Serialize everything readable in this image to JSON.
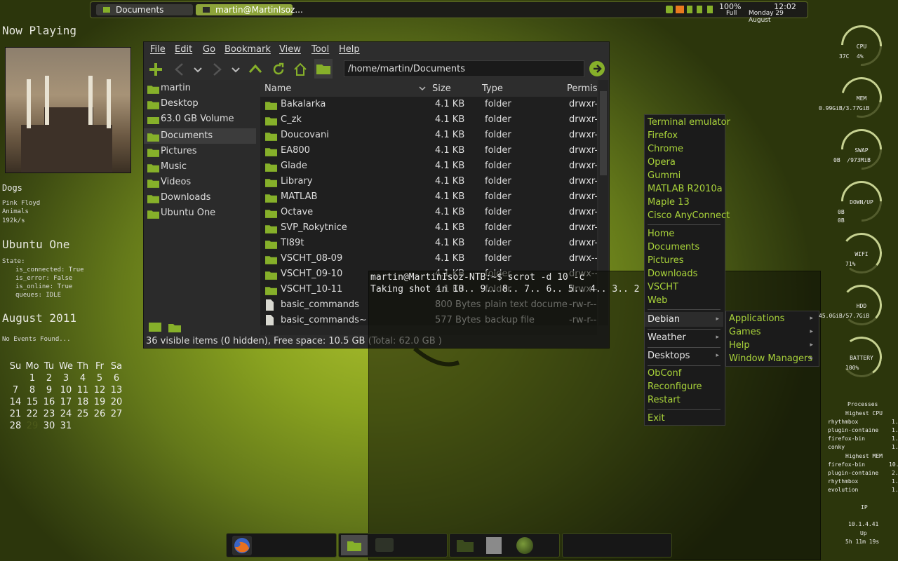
{
  "top_panel": {
    "tasks": [
      {
        "label": "Documents",
        "active": false
      },
      {
        "label": "martin@MartinIsoz...",
        "active": true
      }
    ],
    "battery_percent": "100%",
    "battery_state": "Full",
    "time": "12:02",
    "date": "Monday 29 August"
  },
  "left_conky": {
    "now_playing_title": "Now Playing",
    "track": "Dogs",
    "artist": "Pink Floyd",
    "album": "Animals",
    "bitrate": "192k/s",
    "ubuntu_one_title": "Ubuntu One",
    "state_label": "State:",
    "state_lines": [
      "is_connected: True",
      "is_error: False",
      "is_online: True",
      "queues: IDLE"
    ],
    "calendar_title": "August 2011",
    "events": "No Events Found...",
    "weekdays": [
      "Su",
      "Mo",
      "Tu",
      "We",
      "Th",
      "Fr",
      "Sa"
    ],
    "weeks": [
      [
        "",
        "1",
        "2",
        "3",
        "4",
        "5",
        "6"
      ],
      [
        "7",
        "8",
        "9",
        "10",
        "11",
        "12",
        "13"
      ],
      [
        "14",
        "15",
        "16",
        "17",
        "18",
        "19",
        "20"
      ],
      [
        "21",
        "22",
        "23",
        "24",
        "25",
        "26",
        "27"
      ],
      [
        "28",
        "29",
        "30",
        "31",
        "",
        "",
        ""
      ]
    ],
    "today": "29"
  },
  "file_manager": {
    "menu": [
      "File",
      "Edit",
      "Go",
      "Bookmark",
      "View",
      "Tool",
      "Help"
    ],
    "address": "/home/martin/Documents",
    "sidebar": [
      {
        "label": "martin",
        "selected": false
      },
      {
        "label": "Desktop",
        "selected": false
      },
      {
        "label": "63.0 GB Volume",
        "selected": false
      },
      {
        "label": "Documents",
        "selected": true
      },
      {
        "label": "Pictures",
        "selected": false
      },
      {
        "label": "Music",
        "selected": false
      },
      {
        "label": "Videos",
        "selected": false
      },
      {
        "label": "Downloads",
        "selected": false
      },
      {
        "label": "Ubuntu One",
        "selected": false
      }
    ],
    "columns": [
      "Name",
      "Size",
      "Type",
      "Permis"
    ],
    "rows": [
      {
        "name": "Bakalarka",
        "size": "4.1 KB",
        "type": "folder",
        "perm": "drwxr-:",
        "kind": "folder"
      },
      {
        "name": "C_zk",
        "size": "4.1 KB",
        "type": "folder",
        "perm": "drwxr-:",
        "kind": "folder"
      },
      {
        "name": "Doucovani",
        "size": "4.1 KB",
        "type": "folder",
        "perm": "drwxr-:",
        "kind": "folder"
      },
      {
        "name": "EA800",
        "size": "4.1 KB",
        "type": "folder",
        "perm": "drwxr-:",
        "kind": "folder"
      },
      {
        "name": "Glade",
        "size": "4.1 KB",
        "type": "folder",
        "perm": "drwxr-:",
        "kind": "folder"
      },
      {
        "name": "Library",
        "size": "4.1 KB",
        "type": "folder",
        "perm": "drwxr-:",
        "kind": "folder"
      },
      {
        "name": "MATLAB",
        "size": "4.1 KB",
        "type": "folder",
        "perm": "drwxr-:",
        "kind": "folder"
      },
      {
        "name": "Octave",
        "size": "4.1 KB",
        "type": "folder",
        "perm": "drwxr-:",
        "kind": "folder"
      },
      {
        "name": "SVP_Rokytnice",
        "size": "4.1 KB",
        "type": "folder",
        "perm": "drwxr-:",
        "kind": "folder"
      },
      {
        "name": "TI89t",
        "size": "4.1 KB",
        "type": "folder",
        "perm": "drwxr-:",
        "kind": "folder"
      },
      {
        "name": "VSCHT_08-09",
        "size": "4.1 KB",
        "type": "folder",
        "perm": "drwx--",
        "kind": "folder"
      },
      {
        "name": "VSCHT_09-10",
        "size": "4.1 KB",
        "type": "folder",
        "perm": "drwx--",
        "kind": "folder"
      },
      {
        "name": "VSCHT_10-11",
        "size": "4.1 KB",
        "type": "folder",
        "perm": "drwx--",
        "kind": "folder"
      },
      {
        "name": "basic_commands",
        "size": "800 Bytes",
        "type": "plain text docume",
        "perm": "-rw-r--r",
        "kind": "file"
      },
      {
        "name": "basic_commands~",
        "size": "577 Bytes",
        "type": "backup file",
        "perm": "-rw-r--r",
        "kind": "file"
      }
    ],
    "status": "36 visible items (0 hidden), Free space: 10.5 GB (Total: 62.0 GB )"
  },
  "terminal": {
    "lines": [
      "martin@MartinIsoz-NTB:~$ scrot -d 10 -c",
      "Taking shot in 10.. 9.. 8.. 7.. 6.. 5.. 4.. 3.. 2"
    ]
  },
  "openbox_menu": {
    "groups": [
      [
        "Terminal emulator",
        "Firefox",
        "Chrome",
        "Opera",
        "Gummi",
        "MATLAB R2010a",
        "Maple 13",
        "Cisco AnyConnect"
      ],
      [
        "Home",
        "Documents",
        "Pictures",
        "Downloads",
        "VSCHT",
        "Web"
      ]
    ],
    "submenus": [
      [
        "Debian"
      ],
      [
        "Weather"
      ],
      [
        "Desktops"
      ]
    ],
    "actions": [
      "ObConf",
      "Reconfigure",
      "Restart"
    ],
    "exit": "Exit",
    "debian_submenu": [
      "Applications",
      "Games",
      "Help",
      "Window Managers"
    ]
  },
  "right_conky": {
    "rings": [
      {
        "label": "CPU",
        "value": "4%",
        "extra": "37C",
        "level": 0.04
      },
      {
        "label": "MEM",
        "value": "0.99GiB/3.77GiB",
        "level": 0.26
      },
      {
        "label": "SWAP",
        "value": "0B  /973MiB",
        "level": 0.0
      },
      {
        "label": "DOWN/UP",
        "value": "",
        "level": 0.0
      },
      {
        "label": "WIFI",
        "value": "71%",
        "level": 0.71
      },
      {
        "label": "HDD",
        "value": "45.0GiB/57.7GiB",
        "level": 0.78
      },
      {
        "label": "BATTERY",
        "value": "100%",
        "level": 1.0
      }
    ],
    "down": "0B",
    "up": "0B",
    "processes_title": "Processes",
    "highest_cpu_title": "Highest CPU",
    "highest_cpu": [
      [
        "rhythmbox",
        "1."
      ],
      [
        "plugin-containe",
        "1."
      ],
      [
        "firefox-bin",
        "1."
      ],
      [
        "conky",
        "1."
      ]
    ],
    "highest_mem_title": "Highest MEM",
    "highest_mem": [
      [
        "firefox-bin",
        "10."
      ],
      [
        "plugin-containe",
        "2."
      ],
      [
        "rhythmbox",
        "1."
      ],
      [
        "evolution",
        "1."
      ]
    ],
    "ip_title": "IP",
    "ip": "10.1.4.41",
    "up_title": "Up",
    "uptime": "5h 11m 19s"
  },
  "dock": {
    "icons": [
      "firefox-icon",
      "file-manager-icon",
      "terminal-icon",
      "folder-icon",
      "text-editor-icon",
      "globe-icon"
    ]
  },
  "colors": {
    "accent": "#86b02a",
    "menu_text": "#a9d33a",
    "panel_bg": "#1c1c18"
  }
}
